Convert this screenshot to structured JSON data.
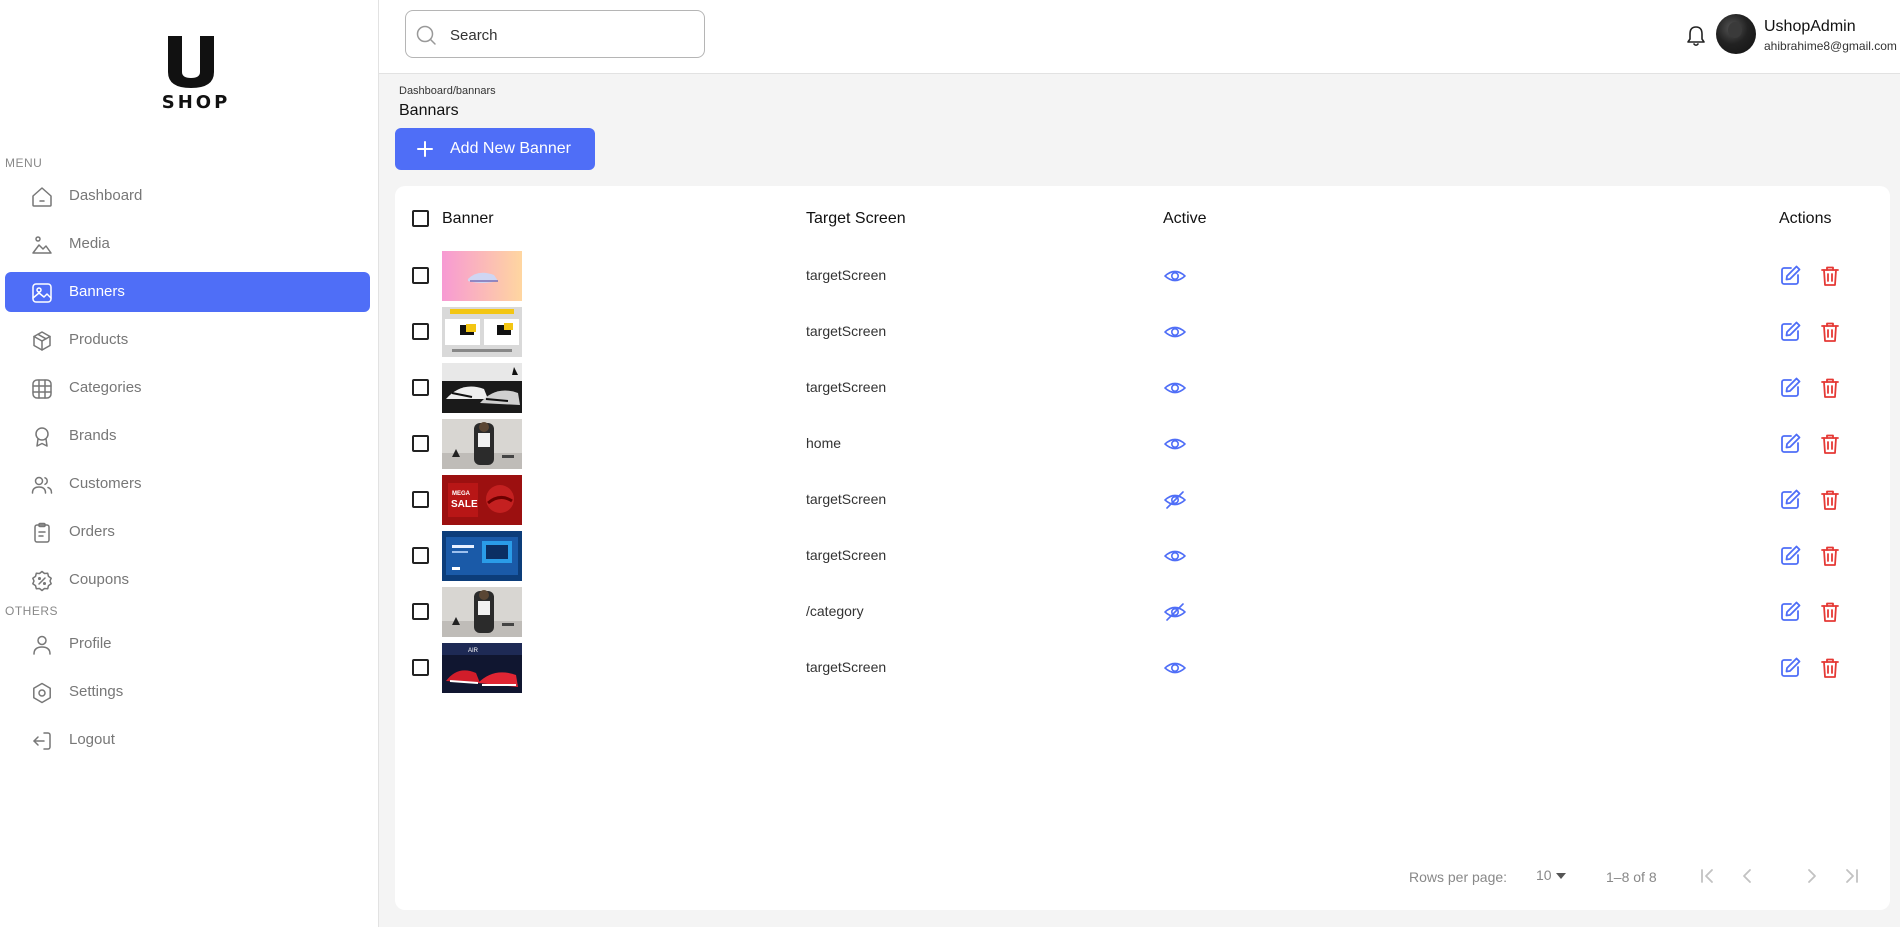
{
  "brand": {
    "logo_letter": "U",
    "logo_text": "SHOP"
  },
  "sidebar": {
    "menu_label": "MENU",
    "others_label": "OTHERS",
    "items": [
      {
        "label": "Dashboard",
        "icon": "home-icon"
      },
      {
        "label": "Media",
        "icon": "image-icon"
      },
      {
        "label": "Banners",
        "icon": "photo-icon",
        "active": true
      },
      {
        "label": "Products",
        "icon": "box-icon"
      },
      {
        "label": "Categories",
        "icon": "grid-icon"
      },
      {
        "label": "Brands",
        "icon": "award-icon"
      },
      {
        "label": "Customers",
        "icon": "users-icon"
      },
      {
        "label": "Orders",
        "icon": "clipboard-icon"
      },
      {
        "label": "Coupons",
        "icon": "discount-icon"
      }
    ],
    "others": [
      {
        "label": "Profile",
        "icon": "user-icon"
      },
      {
        "label": "Settings",
        "icon": "settings-icon"
      },
      {
        "label": "Logout",
        "icon": "logout-icon"
      }
    ]
  },
  "header": {
    "search_placeholder": "Search",
    "user_name": "UshopAdmin",
    "user_email": "ahibrahime8@gmail.com"
  },
  "page": {
    "breadcrumb": "Dashboard/bannars",
    "title": "Bannars",
    "add_button": "Add New Banner"
  },
  "table": {
    "columns": {
      "banner": "Banner",
      "target": "Target Screen",
      "active": "Active",
      "actions": "Actions"
    },
    "rows": [
      {
        "target": "targetScreen",
        "active": true,
        "thumb": "pink-sneaker"
      },
      {
        "target": "targetScreen",
        "active": true,
        "thumb": "yellow-promo"
      },
      {
        "target": "targetScreen",
        "active": true,
        "thumb": "bw-sneakers"
      },
      {
        "target": "home",
        "active": true,
        "thumb": "adidas-model"
      },
      {
        "target": "targetScreen",
        "active": false,
        "thumb": "red-sale"
      },
      {
        "target": "targetScreen",
        "active": true,
        "thumb": "blue-tech"
      },
      {
        "target": "/category",
        "active": false,
        "thumb": "adidas-model"
      },
      {
        "target": "targetScreen",
        "active": true,
        "thumb": "red-shoes-dark"
      }
    ]
  },
  "pagination": {
    "rows_per_page_label": "Rows per page:",
    "rows_per_page": "10",
    "range": "1–8 of 8"
  },
  "colors": {
    "accent": "#4f6ef7",
    "danger": "#e53935"
  }
}
